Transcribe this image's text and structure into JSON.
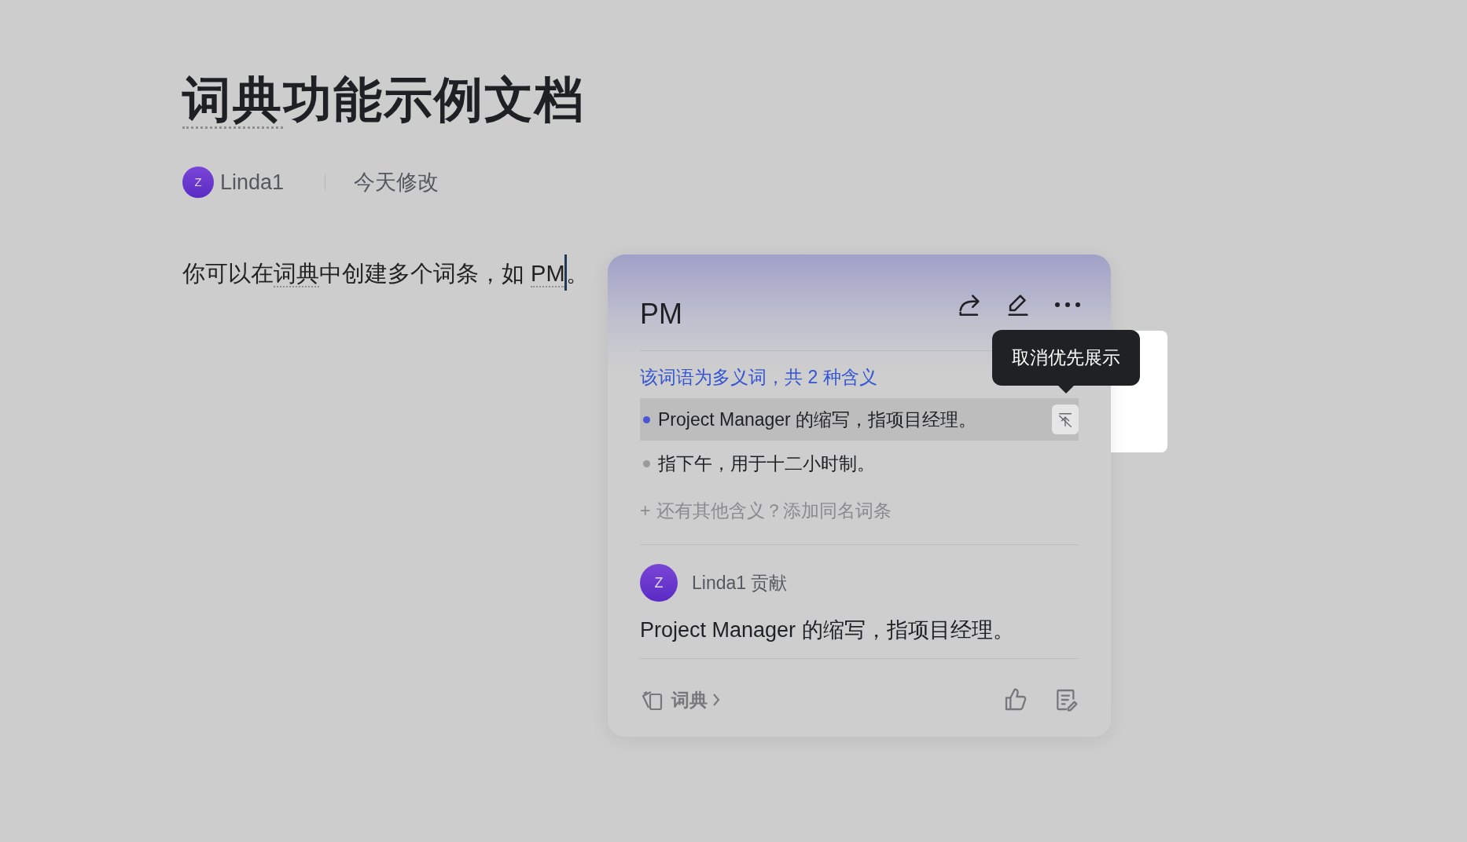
{
  "document": {
    "title": [
      {
        "text": "词典",
        "term": true
      },
      {
        "text": "功能示例文档",
        "term": false
      }
    ],
    "author": {
      "avatar": "Z",
      "name": "Linda1"
    },
    "modified": "今天修改",
    "body": [
      {
        "text": "你可以在",
        "term": false
      },
      {
        "text": "词典",
        "term": true
      },
      {
        "text": "中创建多个词条，如 ",
        "term": false
      },
      {
        "text": "PM",
        "term": true
      },
      {
        "text": "。",
        "term": false
      }
    ]
  },
  "term_card": {
    "term": "PM",
    "polysemy_note": "该词语为多义词，共 2 种含义",
    "meanings": [
      {
        "text": "Project Manager 的缩写，指项目经理。",
        "selected": true
      },
      {
        "text": "指下午，用于十二小时制。",
        "selected": false
      }
    ],
    "add_meaning": {
      "plus": "+",
      "label": "还有其他含义？添加同名词条"
    },
    "contributor": {
      "avatar": "Z",
      "label": "Linda1 贡献"
    },
    "definition": "Project Manager 的缩写，指项目经理。",
    "source": "词典",
    "tooltip": "取消优先展示"
  }
}
